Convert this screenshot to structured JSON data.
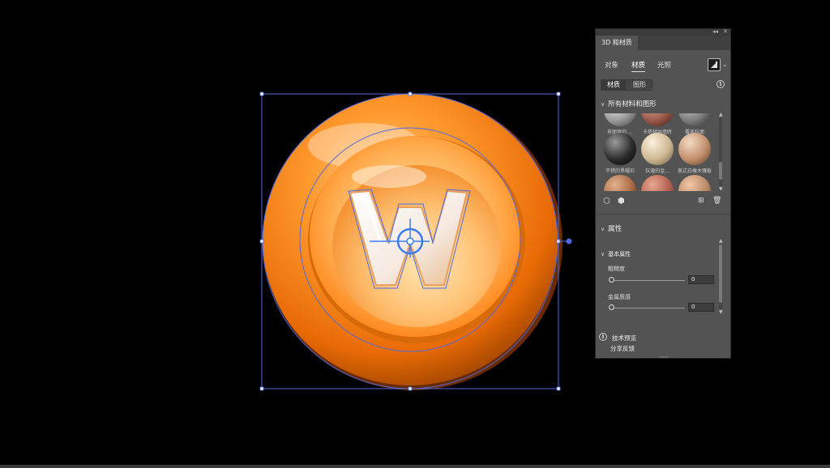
{
  "panel": {
    "title": "3D 和材质",
    "tabs": [
      "对象",
      "材质",
      "光照"
    ],
    "active_tab": "材质",
    "segment": [
      "材质",
      "图形"
    ],
    "materials_section": "所有材料和图形",
    "materials": [
      {
        "label": "有图案的 ...",
        "colors": [
          "#f2f2f2",
          "#9a9a9a",
          "#3c3c3c"
        ]
      },
      {
        "label": "卡塔赫纳墙砖",
        "colors": [
          "#e0ad97",
          "#9a5a4a",
          "#3a1a14"
        ]
      },
      {
        "label": "覆盖抗面",
        "colors": [
          "#d0d0d0",
          "#7c7c7c",
          "#2a2a2a"
        ]
      },
      {
        "label": "不锈的黑曜石",
        "colors": [
          "#9a9a9a",
          "#2c2c2c",
          "#050505"
        ]
      },
      {
        "label": "抗皱的金...",
        "colors": [
          "#fbf1db",
          "#cdb792",
          "#6a5a40"
        ]
      },
      {
        "label": "美式白橡木镶板",
        "colors": [
          "#f3d9c4",
          "#c28f6c",
          "#5a3a24"
        ]
      },
      {
        "label": "",
        "colors": [
          "#e3b28e",
          "#a86a44",
          "#4a2a18"
        ]
      },
      {
        "label": "",
        "colors": [
          "#e8a88e",
          "#b26050",
          "#4a2a20"
        ]
      },
      {
        "label": "",
        "colors": [
          "#f2c6a8",
          "#b88a66",
          "#5a3a24"
        ]
      }
    ],
    "properties_section": "属性",
    "basic_properties": "基本属性",
    "roughness_label": "粗糙度",
    "roughness_value": "0",
    "roughness_level": 0,
    "metallic_label": "金属质感",
    "metallic_value": "0",
    "metallic_level": 0,
    "tech_preview": "技术预览",
    "feedback": "分享反馈",
    "top_controls": [
      "◂◂",
      "✕"
    ]
  },
  "colors": {
    "accent": "#4f6ae0",
    "coin_outer": "#ff8c1a",
    "coin_inner": "#ffb060",
    "panel_bg": "#535353"
  },
  "icons": {
    "info": "info-icon",
    "add": "add-icon",
    "delete": "trash-icon",
    "cube": "cube-icon",
    "cube_add": "cube-add-icon"
  }
}
